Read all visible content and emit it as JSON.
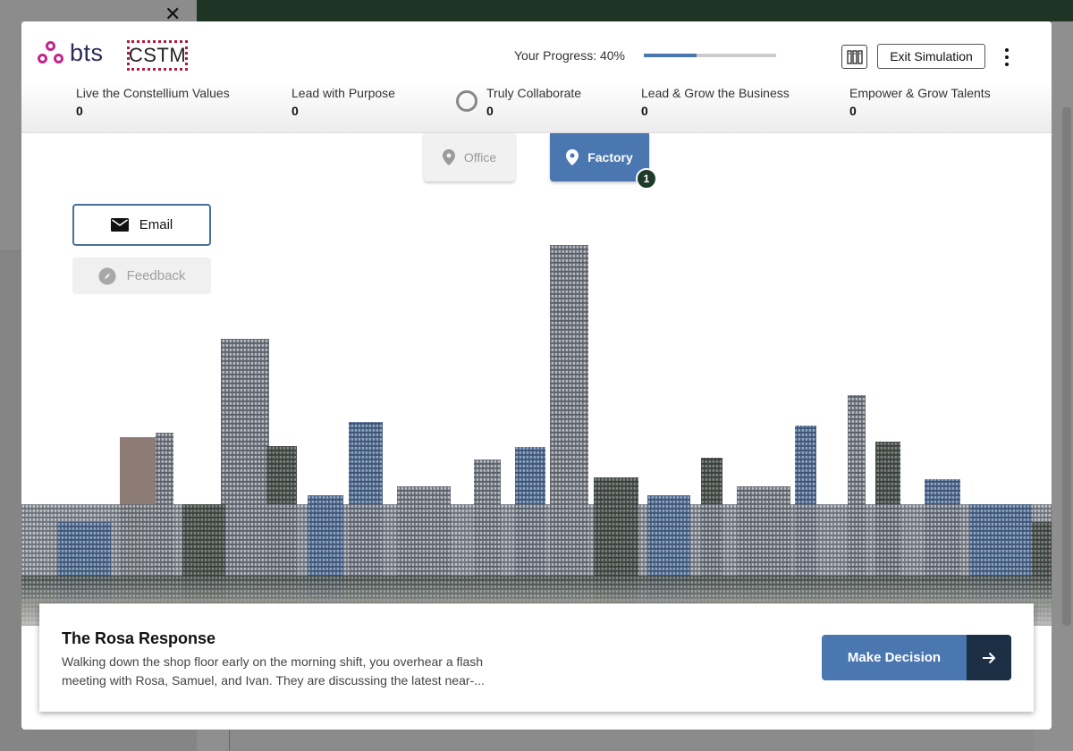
{
  "header": {
    "bts_logo": "bts",
    "cstm_logo": "CSTM",
    "progress_label": "Your Progress: 40%",
    "progress_fraction": 0.4,
    "exit_label": "Exit Simulation"
  },
  "values": [
    {
      "label": "Live the Constellium Values",
      "score": "0"
    },
    {
      "label": "Lead with Purpose",
      "score": "0"
    },
    {
      "label": "Truly Collaborate",
      "score": "0"
    },
    {
      "label": "Lead & Grow the Business",
      "score": "0"
    },
    {
      "label": "Empower & Grow Talents",
      "score": "0"
    }
  ],
  "locations": {
    "office": "Office",
    "factory": "Factory",
    "factory_badge": "1"
  },
  "side": {
    "email": "Email",
    "feedback": "Feedback"
  },
  "card": {
    "title": "The Rosa Response",
    "text": "Walking down the shop floor early on the morning shift, you overhear a flash meeting with Rosa, Samuel, and Ivan. They are discussing the latest near-...",
    "button": "Make Decision"
  },
  "colors": {
    "accent": "#4a77b0",
    "dark_green": "#1e3a2b",
    "navy": "#1d2f45",
    "brand_magenta": "#c2268b"
  }
}
